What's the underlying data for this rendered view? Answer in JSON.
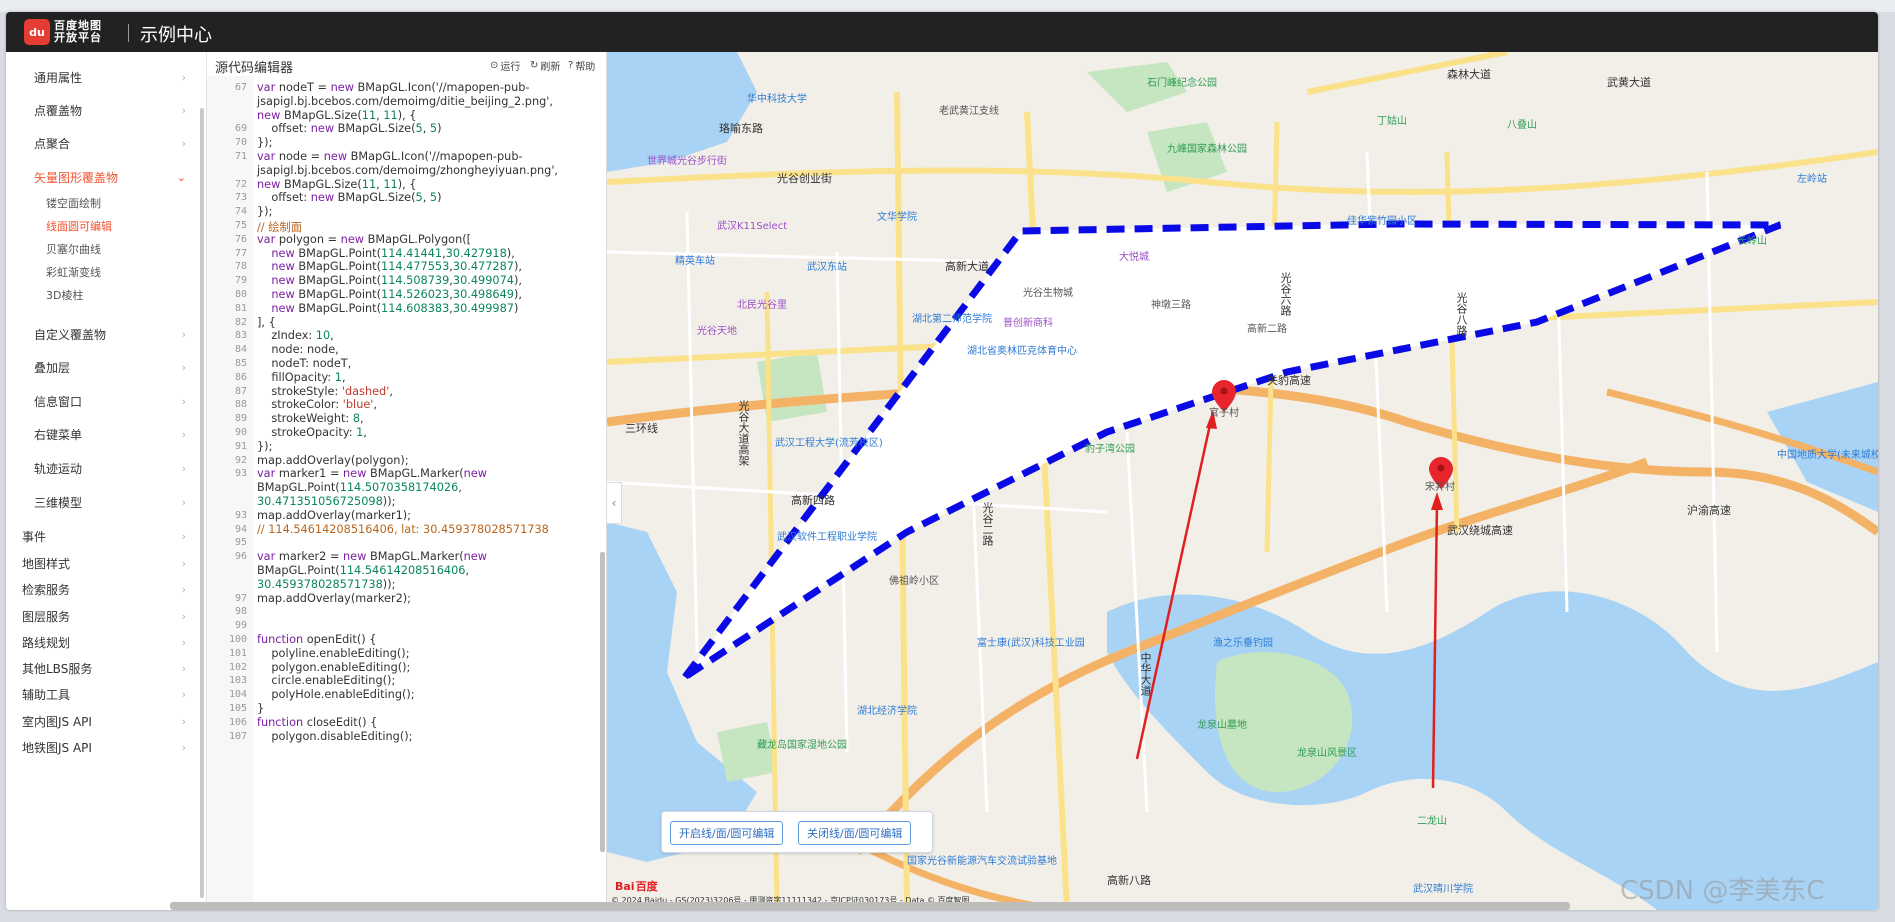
{
  "header": {
    "logo_line1": "百度地图",
    "logo_line2": "开放平台",
    "logo_badge": "du",
    "site_title": "示例中心"
  },
  "sidebar": {
    "items": [
      {
        "label": "通用属性",
        "level": "group"
      },
      {
        "label": "点覆盖物",
        "level": "group"
      },
      {
        "label": "点聚合",
        "level": "group"
      },
      {
        "label": "矢量图形覆盖物",
        "level": "group",
        "active": true,
        "expanded": true
      },
      {
        "label": "镂空面绘制",
        "level": "sub"
      },
      {
        "label": "线面圆可编辑",
        "level": "sub",
        "active": true
      },
      {
        "label": "贝塞尔曲线",
        "level": "sub"
      },
      {
        "label": "彩虹渐变线",
        "level": "sub"
      },
      {
        "label": "3D棱柱",
        "level": "sub"
      },
      {
        "label": "自定义覆盖物",
        "level": "group"
      },
      {
        "label": "叠加层",
        "level": "group"
      },
      {
        "label": "信息窗口",
        "level": "group"
      },
      {
        "label": "右键菜单",
        "level": "group"
      },
      {
        "label": "轨迹运动",
        "level": "group"
      },
      {
        "label": "三维模型",
        "level": "group"
      },
      {
        "label": "事件",
        "level": "top"
      },
      {
        "label": "地图样式",
        "level": "top"
      },
      {
        "label": "检索服务",
        "level": "top"
      },
      {
        "label": "图层服务",
        "level": "top"
      },
      {
        "label": "路线规划",
        "level": "top"
      },
      {
        "label": "其他LBS服务",
        "level": "top"
      },
      {
        "label": "辅助工具",
        "level": "top"
      },
      {
        "label": "室内图JS API",
        "level": "top"
      },
      {
        "label": "地铁图JS API",
        "level": "top"
      }
    ],
    "active_color": "#f15533"
  },
  "editor": {
    "title": "源代码编辑器",
    "run_label": "运行",
    "refresh_label": "刷新",
    "help_label": "帮助",
    "lines": [
      {
        "n": "67",
        "t": "var nodeT = new BMapGL.Icon('//mapopen-pub-"
      },
      {
        "n": "",
        "t": "jsapigl.bj.bcebos.com/demoimg/ditie_beijing_2.png',"
      },
      {
        "n": "",
        "t": "new BMapGL.Size(11, 11), {"
      },
      {
        "n": "69",
        "t": "    offset: new BMapGL.Size(5, 5)"
      },
      {
        "n": "70",
        "t": "});"
      },
      {
        "n": "71",
        "t": "var node = new BMapGL.Icon('//mapopen-pub-"
      },
      {
        "n": "",
        "t": "jsapigl.bj.bcebos.com/demoimg/zhongheyiyuan.png',"
      },
      {
        "n": "72",
        "t": "new BMapGL.Size(11, 11), {"
      },
      {
        "n": "73",
        "t": "    offset: new BMapGL.Size(5, 5)"
      },
      {
        "n": "74",
        "t": "});"
      },
      {
        "n": "75",
        "t": "// 绘制面"
      },
      {
        "n": "76",
        "t": "var polygon = new BMapGL.Polygon(["
      },
      {
        "n": "77",
        "t": "    new BMapGL.Point(114.41441,30.427918),"
      },
      {
        "n": "78",
        "t": "    new BMapGL.Point(114.477553,30.477287),"
      },
      {
        "n": "79",
        "t": "    new BMapGL.Point(114.508739,30.499074),"
      },
      {
        "n": "80",
        "t": "    new BMapGL.Point(114.526023,30.498649),"
      },
      {
        "n": "81",
        "t": "    new BMapGL.Point(114.608383,30.499987)"
      },
      {
        "n": "82",
        "t": "], {"
      },
      {
        "n": "83",
        "t": "    zIndex: 10,"
      },
      {
        "n": "84",
        "t": "    node: node,"
      },
      {
        "n": "85",
        "t": "    nodeT: nodeT,"
      },
      {
        "n": "86",
        "t": "    fillOpacity: 1,"
      },
      {
        "n": "87",
        "t": "    strokeStyle: 'dashed',"
      },
      {
        "n": "88",
        "t": "    strokeColor: 'blue',"
      },
      {
        "n": "89",
        "t": "    strokeWeight: 8,"
      },
      {
        "n": "90",
        "t": "    strokeOpacity: 1,"
      },
      {
        "n": "91",
        "t": "});"
      },
      {
        "n": "92",
        "t": "map.addOverlay(polygon);"
      },
      {
        "n": "93",
        "t": "var marker1 = new BMapGL.Marker(new"
      },
      {
        "n": "",
        "t": "BMapGL.Point(114.5070358174026,"
      },
      {
        "n": "",
        "t": "30.471351056725098));"
      },
      {
        "n": "93",
        "t": "map.addOverlay(marker1);"
      },
      {
        "n": "94",
        "t": "// 114.54614208516406, lat: 30.459378028571738"
      },
      {
        "n": "95",
        "t": ""
      },
      {
        "n": "96",
        "t": "var marker2 = new BMapGL.Marker(new"
      },
      {
        "n": "",
        "t": "BMapGL.Point(114.54614208516406,"
      },
      {
        "n": "",
        "t": "30.459378028571738));"
      },
      {
        "n": "97",
        "t": "map.addOverlay(marker2);"
      },
      {
        "n": "98",
        "t": ""
      },
      {
        "n": "99",
        "t": ""
      },
      {
        "n": "100",
        "t": "function openEdit() {"
      },
      {
        "n": "101",
        "t": "    polyline.enableEditing();"
      },
      {
        "n": "102",
        "t": "    polygon.enableEditing();"
      },
      {
        "n": "103",
        "t": "    circle.enableEditing();"
      },
      {
        "n": "104",
        "t": "    polyHole.enableEditing();"
      },
      {
        "n": "105",
        "t": "}"
      },
      {
        "n": "106",
        "t": "function closeEdit() {"
      },
      {
        "n": "107",
        "t": "    polygon.disableEditing();"
      }
    ]
  },
  "map": {
    "open_edit_label": "开启线/面/圆可编辑",
    "close_edit_label": "关闭线/面/圆可编辑",
    "logo_text": "Bai",
    "logo_text2": "百度",
    "copyright": "© 2024 Baidu - GS(2023)3206号 - 甲测资字11111342 - 京ICP证030173号 - Data © 百度智图",
    "polygon_stroke": "#0000ee",
    "marker_color": "#e8242c",
    "arrow_color": "#e02020",
    "labels": {
      "l1": "华中科技大学",
      "l2": "石门峰纪念公园",
      "l3": "森林大道",
      "l4": "武黄大道",
      "l5": "老武黄江支线",
      "l6": "珞喻东路",
      "l7": "九峰国家森林公园",
      "l8": "丁姑山",
      "l9": "八叠山",
      "l10": "世界城光谷步行街",
      "l11": "光谷创业街",
      "l12": "武汉K11Select",
      "l13": "文华学院",
      "l14": "佳华紫竹园小区",
      "l15": "精英车站",
      "l16": "武汉东站",
      "l17": "高新大道",
      "l18": "大悦城",
      "l19": "长岭山",
      "l20": "北民光谷里",
      "l21": "湖北第二师范学院",
      "l22": "光谷生物城",
      "l23": "普创新商科",
      "l24": "光谷天地",
      "l25": "湖北省奥林匹克体育中心",
      "l26": "神墩三路",
      "l27": "高新二路",
      "l28": "关豹高速",
      "l29": "三环线",
      "l30": "光谷大道高架",
      "l31": "武汉工程大学(流芳校区)",
      "l32": "高新四路",
      "l33": "豹子湾公园",
      "l34": "武汉软件工程职业学院",
      "l35": "光谷二路",
      "l36": "佛祖岭小区",
      "l37": "富士康(武汉)科技工业园",
      "l38": "渔之乐垂钓园",
      "l39": "武汉绕城高速",
      "l40": "湖北经济学院",
      "l41": "藏龙岛国家湿地公园",
      "l42": "龙泉山墓地",
      "l43": "龙泉山风景区",
      "l44": "二龙山",
      "l45": "高新八路",
      "l46": "国家光谷新能源汽车交流试验基地",
      "l47": "武汉晴川学院",
      "l48": "中国地质大学(未来城校区)",
      "l49": "沪渝高速",
      "l50": "中华大道",
      "l51": "光谷八路",
      "l52": "光谷六路",
      "l53": "左岭站",
      "l54": "官子村",
      "l55": "宋井村"
    }
  },
  "watermark": "CSDN @李美东C"
}
